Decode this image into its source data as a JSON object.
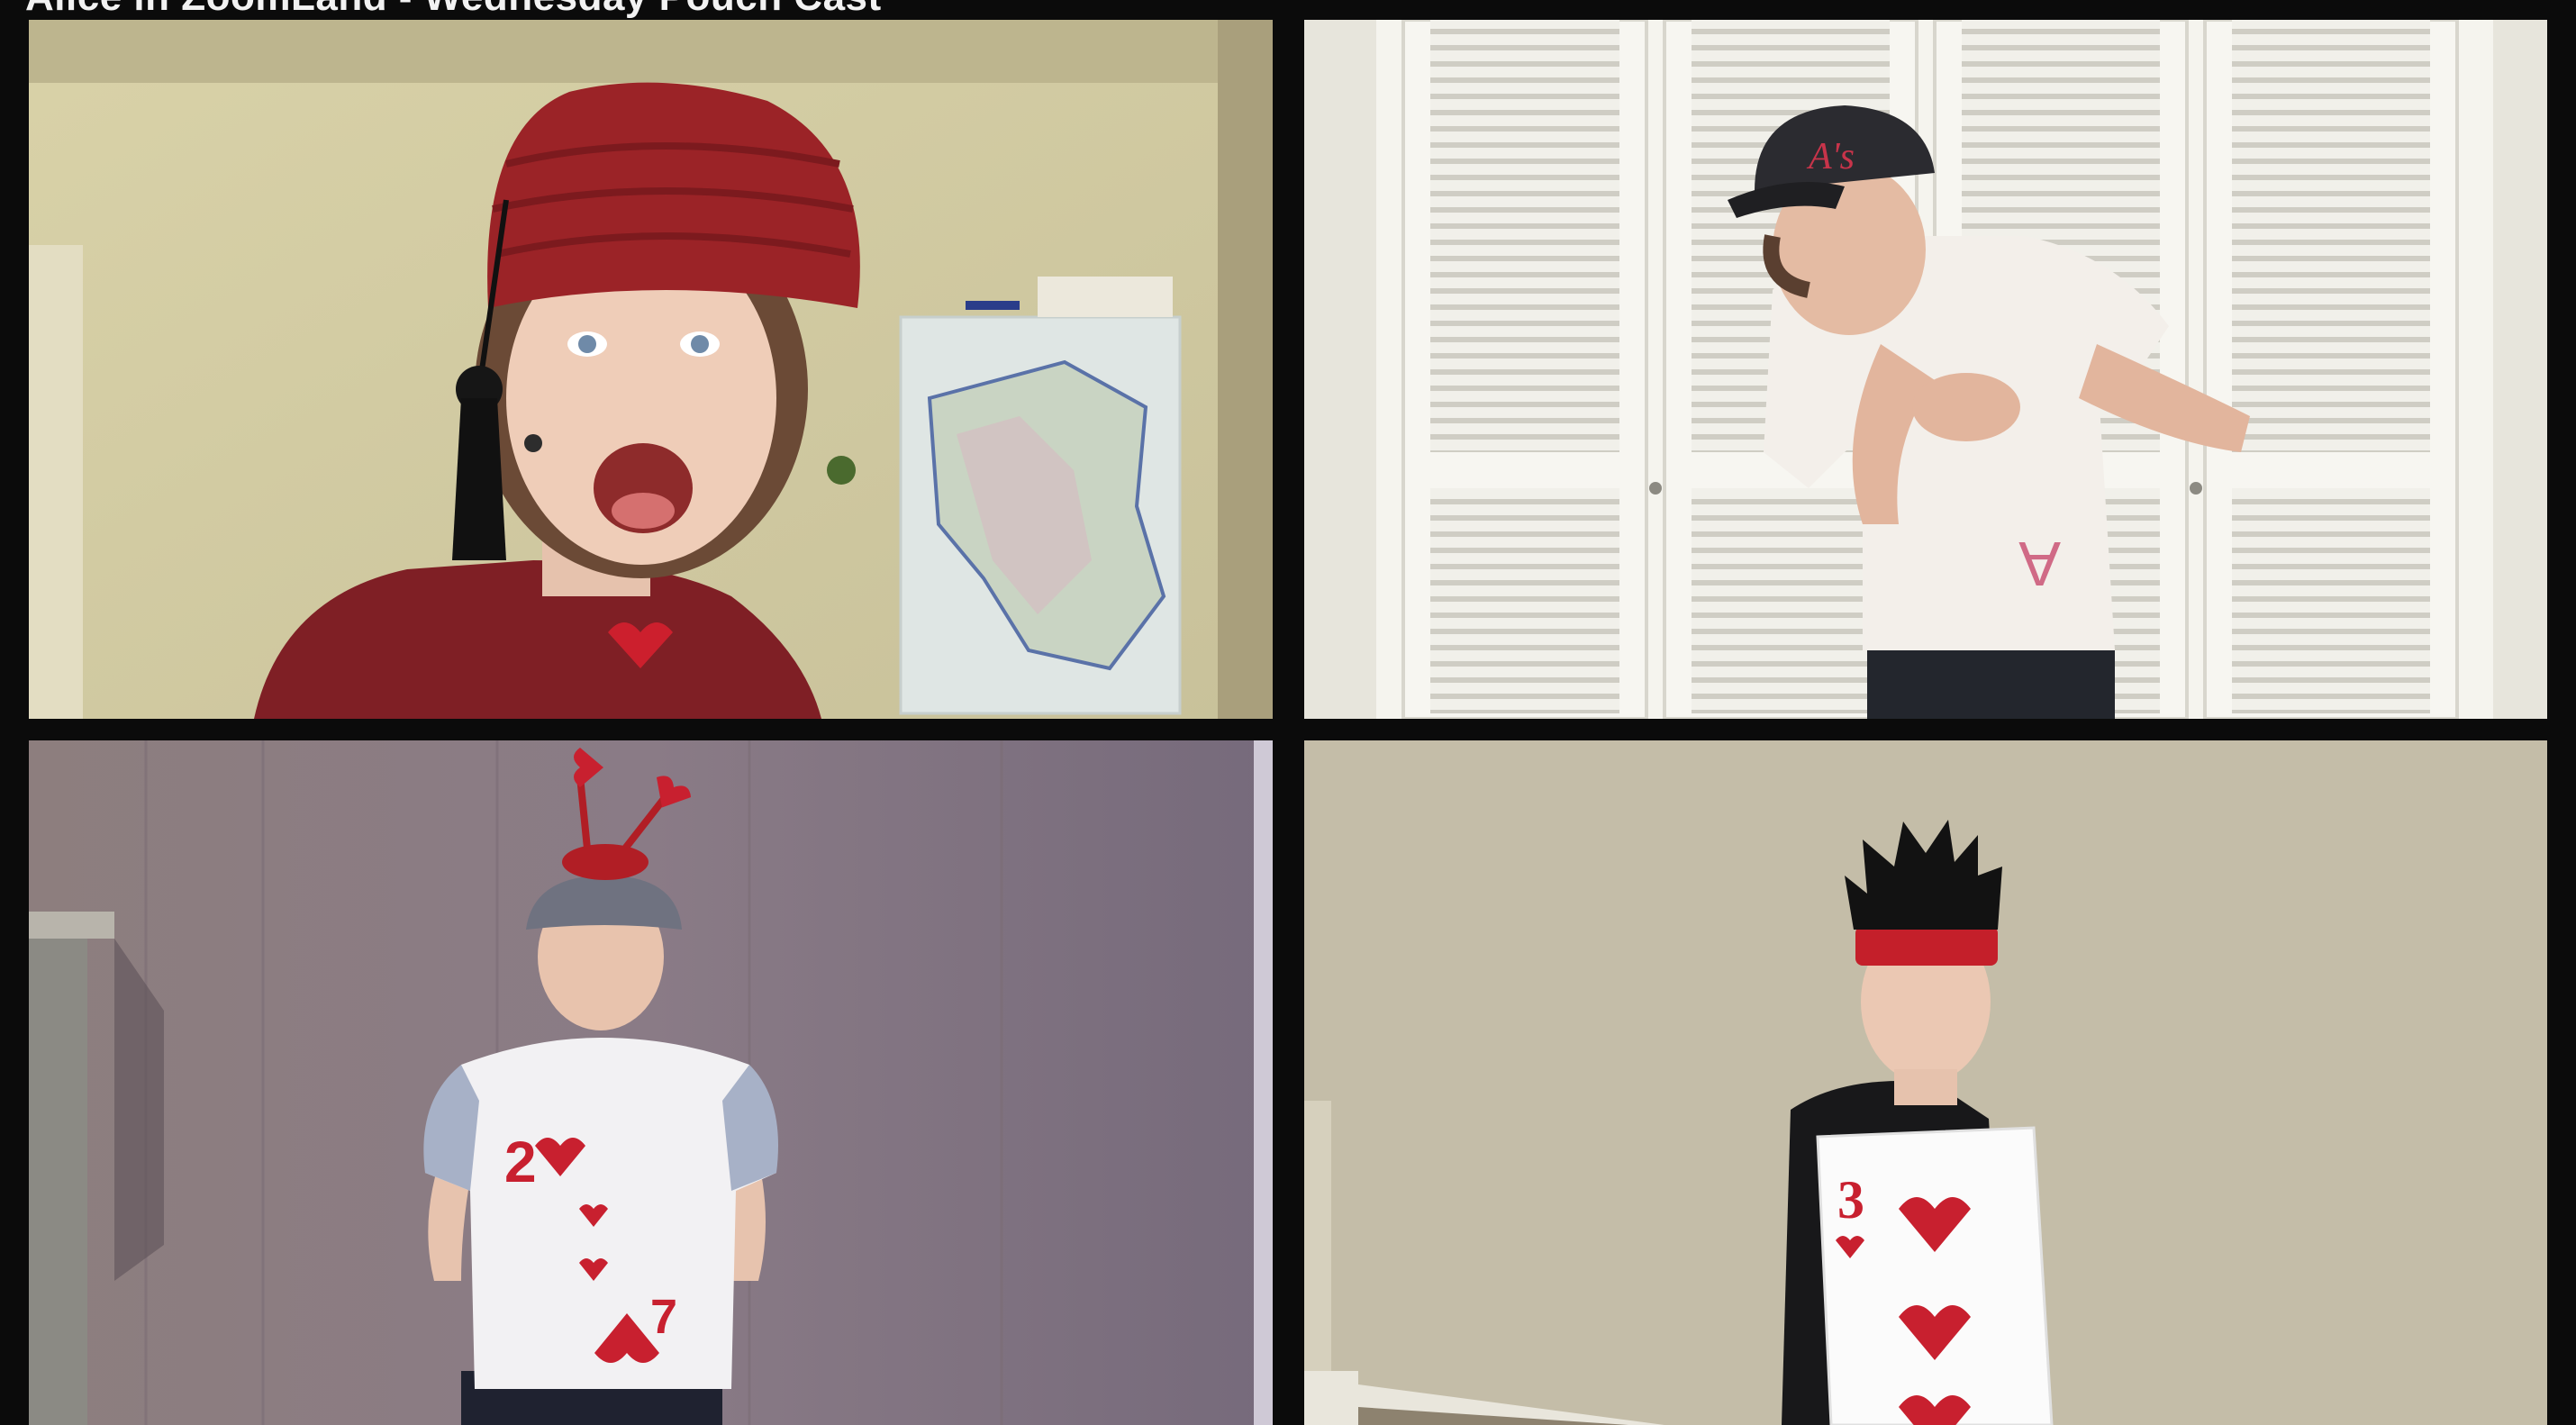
{
  "window": {
    "title": "Alice in ZoomLand - Wednesday Pouch Cast"
  },
  "video_grid": {
    "tiles": [
      {
        "participant_label": ""
      },
      {
        "participant_label": ""
      },
      {
        "participant_label": ""
      },
      {
        "participant_label": ""
      }
    ]
  },
  "costume_text": {
    "cap_logo": "A's",
    "shirt_number": "2",
    "shirt_rank_bottom": "7",
    "card_rank": "3"
  },
  "colors": {
    "background": "#0b0b0b",
    "title_text": "#f2f2f2",
    "heart_red": "#cc1f2d"
  }
}
